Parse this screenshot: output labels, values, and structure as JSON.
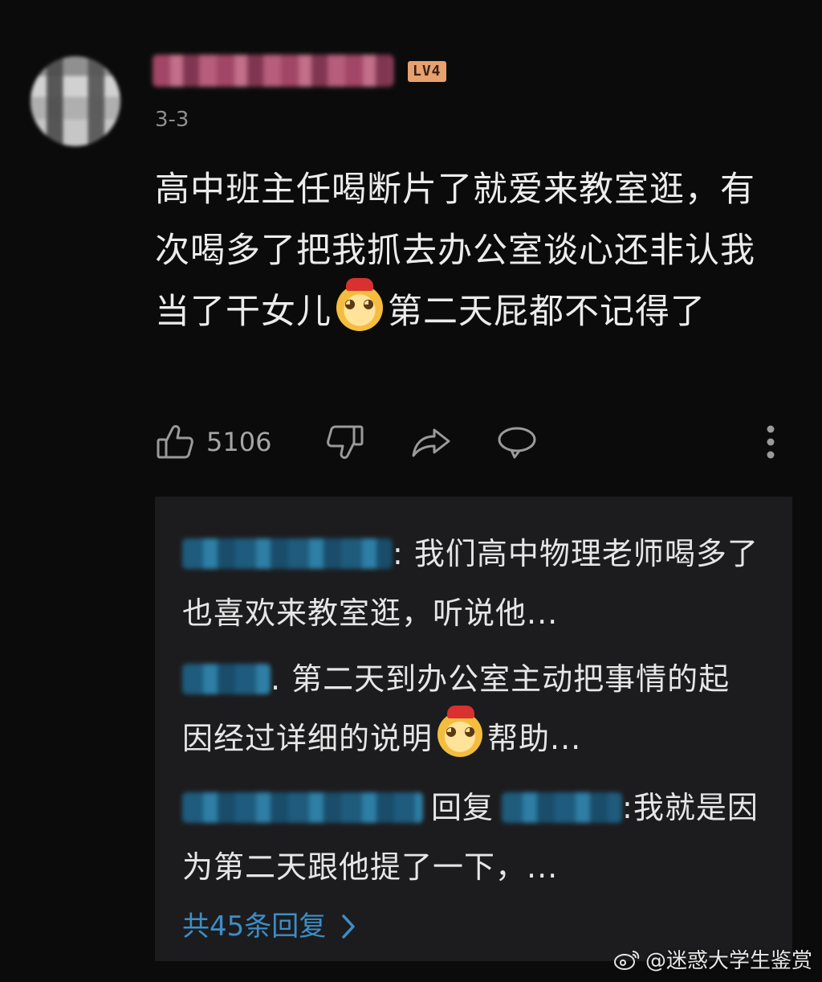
{
  "header": {
    "level_badge": "LV4",
    "date": "3-3"
  },
  "comment": {
    "text_before_emoji": "高中班主任喝断片了就爱来教室逛，有次喝多了把我抓去办公室谈心还非认我当了干女儿",
    "emoji_icon": "doge-cat-emoji",
    "text_after_emoji": "第二天屁都不记得了"
  },
  "actions": {
    "like_count": "5106",
    "like_icon": "thumbs-up-icon",
    "dislike_icon": "thumbs-down-icon",
    "share_icon": "share-icon",
    "reply_icon": "comment-icon",
    "more_icon": "more-vertical-icon"
  },
  "replies": [
    {
      "text": ": 我们高中物理老师喝多了也喜欢来教室逛，听说他..."
    },
    {
      "text_before_emoji": ". 第二天到办公室主动把事情的起因经过详细的说明",
      "text_after_emoji": "帮助..."
    },
    {
      "reply_word": "回复",
      "text": ":我就是因为第二天跟他提了一下，..."
    }
  ],
  "view_more": {
    "label": "共45条回复"
  },
  "watermark": {
    "text": "@迷惑大学生鉴赏"
  },
  "colors": {
    "background": "#0b0b0b",
    "reply_panel": "#1c1c1e",
    "link_blue": "#3d8ec7",
    "level_badge": "#e7a16f"
  }
}
